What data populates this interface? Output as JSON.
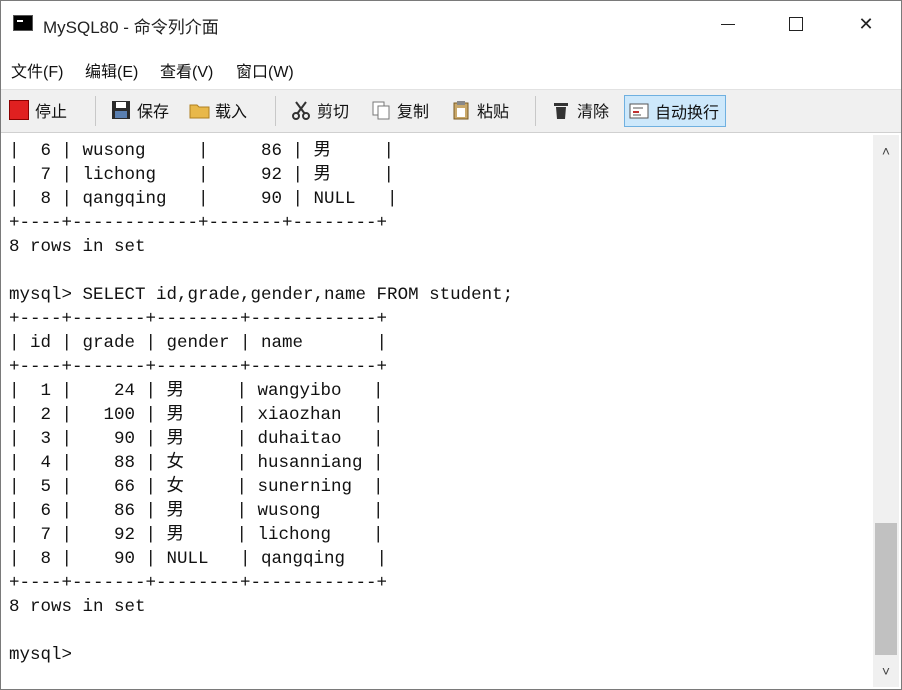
{
  "window": {
    "title": "MySQL80 - 命令列介面"
  },
  "window_controls": {
    "minimize": "—",
    "maximize": "☐",
    "close": "✕"
  },
  "menu": [
    "文件(F)",
    "编辑(E)",
    "查看(V)",
    "窗口(W)"
  ],
  "toolbar": {
    "stop": "停止",
    "save": "保存",
    "load": "载入",
    "cut": "剪切",
    "copy": "复制",
    "paste": "粘贴",
    "clear": "清除",
    "word_wrap": "自动换行"
  },
  "icons": {
    "stop": "stop-icon",
    "save": "floppy-icon",
    "load": "folder-icon",
    "cut": "scissors-icon",
    "copy": "copy-icon",
    "paste": "clipboard-icon",
    "clear": "trash-icon",
    "word_wrap": "wrap-icon"
  },
  "console": {
    "text": "|  6 | wusong     |     86 | 男     |\n|  7 | lichong    |     92 | 男     |\n|  8 | qangqing   |     90 | NULL   |\n+----+------------+-------+--------+\n8 rows in set\n\nmysql> SELECT id,grade,gender,name FROM student;\n+----+-------+--------+------------+\n| id | grade | gender | name       |\n+----+-------+--------+------------+\n|  1 |    24 | 男     | wangyibo   |\n|  2 |   100 | 男     | xiaozhan   |\n|  3 |    90 | 男     | duhaitao   |\n|  4 |    88 | 女     | husanniang |\n|  5 |    66 | 女     | sunerning  |\n|  6 |    86 | 男     | wusong     |\n|  7 |    92 | 男     | lichong    |\n|  8 |    90 | NULL   | qangqing   |\n+----+-------+--------+------------+\n8 rows in set\n\nmysql>"
  },
  "colors": {
    "stop_red": "#e02020",
    "active_bg": "#cde8fb",
    "toolbar_bg": "#f0f0f0"
  }
}
